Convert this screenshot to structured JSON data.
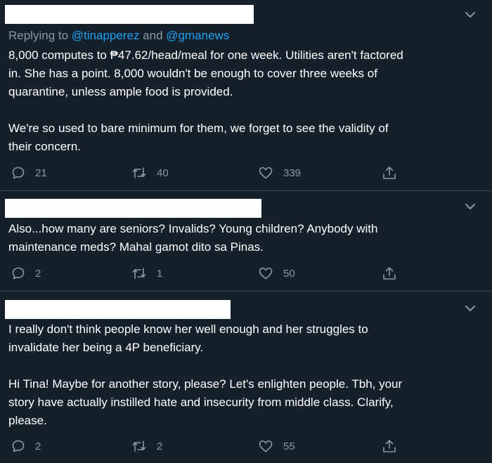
{
  "tweets": [
    {
      "reply_prefix": "Replying to ",
      "mention1": "@tinapperez",
      "reply_and": " and ",
      "mention2": "@gmanews",
      "text": "8,000 computes to ₱47.62/head/meal for one week. Utilities aren't factored\nin. She has a point. 8,000 wouldn't be enough to cover three weeks of\nquarantine, unless ample food is provided.\n\nWe're so used to bare minimum for them, we forget to see the validity of\ntheir concern.",
      "replies": "21",
      "retweets": "40",
      "likes": "339"
    },
    {
      "text": "Also...how many are seniors? Invalids? Young children? Anybody with\nmaintenance meds? Mahal gamot dito sa Pinas.",
      "replies": "2",
      "retweets": "1",
      "likes": "50"
    },
    {
      "text": "I really don't think people know her well enough and her struggles to\ninvalidate her being a 4P beneficiary.\n\nHi Tina! Maybe for another story, please? Let's enlighten people. Tbh, your\nstory have actually instilled hate and insecurity from middle class. Clarify,\nplease.",
      "replies": "2",
      "retweets": "2",
      "likes": "55"
    }
  ],
  "icons": {
    "reply": "speech-bubble-icon",
    "retweet": "retweet-icon",
    "like": "heart-icon",
    "share": "share-icon",
    "menu": "chevron-down-icon"
  },
  "colors": {
    "background": "#15202b",
    "text": "#ffffff",
    "muted": "#8899a6",
    "link": "#1da1f2",
    "divider": "#38444d"
  }
}
